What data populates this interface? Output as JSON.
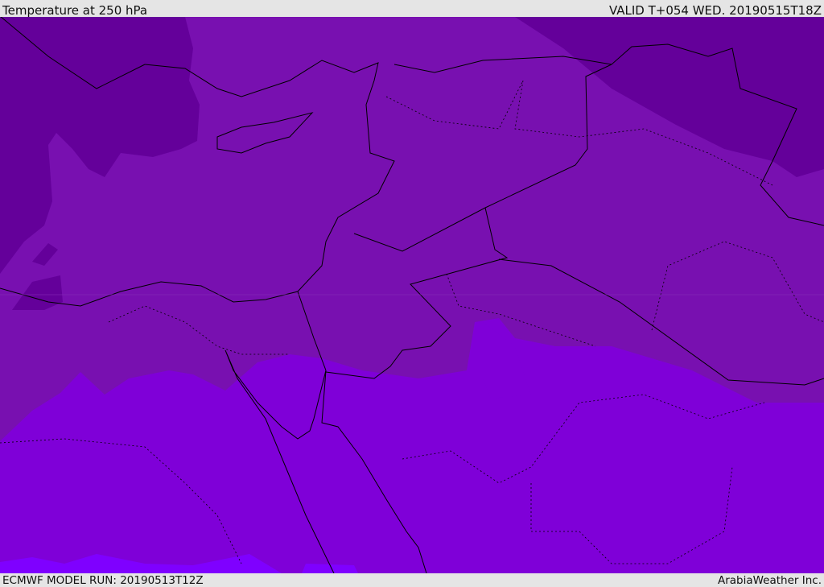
{
  "header": {
    "title": "Temperature at 250 hPa",
    "valid": "VALID T+054 WED. 20190515T18Z"
  },
  "footer": {
    "model_run": "ECMWF MODEL RUN: 20190513T12Z",
    "credit": "ArabiaWeather Inc."
  },
  "colors": {
    "coldest": "#64009a",
    "cold": "#7810b0",
    "mid": "#7f00d8",
    "warm": "#7f00ff",
    "border": "#000000",
    "background": "#e5e5e5"
  }
}
